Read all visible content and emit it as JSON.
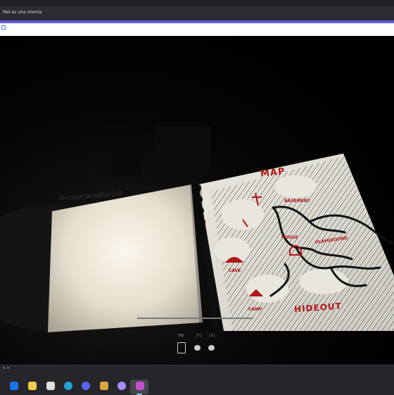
{
  "window": {
    "tab_title": "Mal es una mierda"
  },
  "game": {
    "journal": {
      "left_page_title": "Recoge papillas 1/8"
    },
    "map": {
      "title": "MAP",
      "locations": {
        "basement": "BASEMENT",
        "house": "HOUSE",
        "playground": "PLAYGROUND",
        "cave": "CAVE",
        "camp": "CAMP",
        "hideout": "HIDEOUT"
      }
    },
    "hud": {
      "keys": [
        "TAB",
        "[F]",
        "[G]"
      ]
    }
  },
  "taskbar": {
    "apps": [
      {
        "name": "outlook",
        "color": "#1a73e8"
      },
      {
        "name": "file-explorer",
        "color": "#f2c94c"
      },
      {
        "name": "calendar",
        "color": "#e0e0e0"
      },
      {
        "name": "edge",
        "color": "#1fa3d9"
      },
      {
        "name": "discord",
        "color": "#5865f2"
      },
      {
        "name": "game-app",
        "color": "#d9a441"
      },
      {
        "name": "purple-app",
        "color": "#a78bfa"
      },
      {
        "name": "active-game",
        "color": "#c14fd0"
      }
    ]
  },
  "colors": {
    "map_ink": "#b01818",
    "paper": "#efeae0",
    "accent": "#5b5bd9"
  }
}
